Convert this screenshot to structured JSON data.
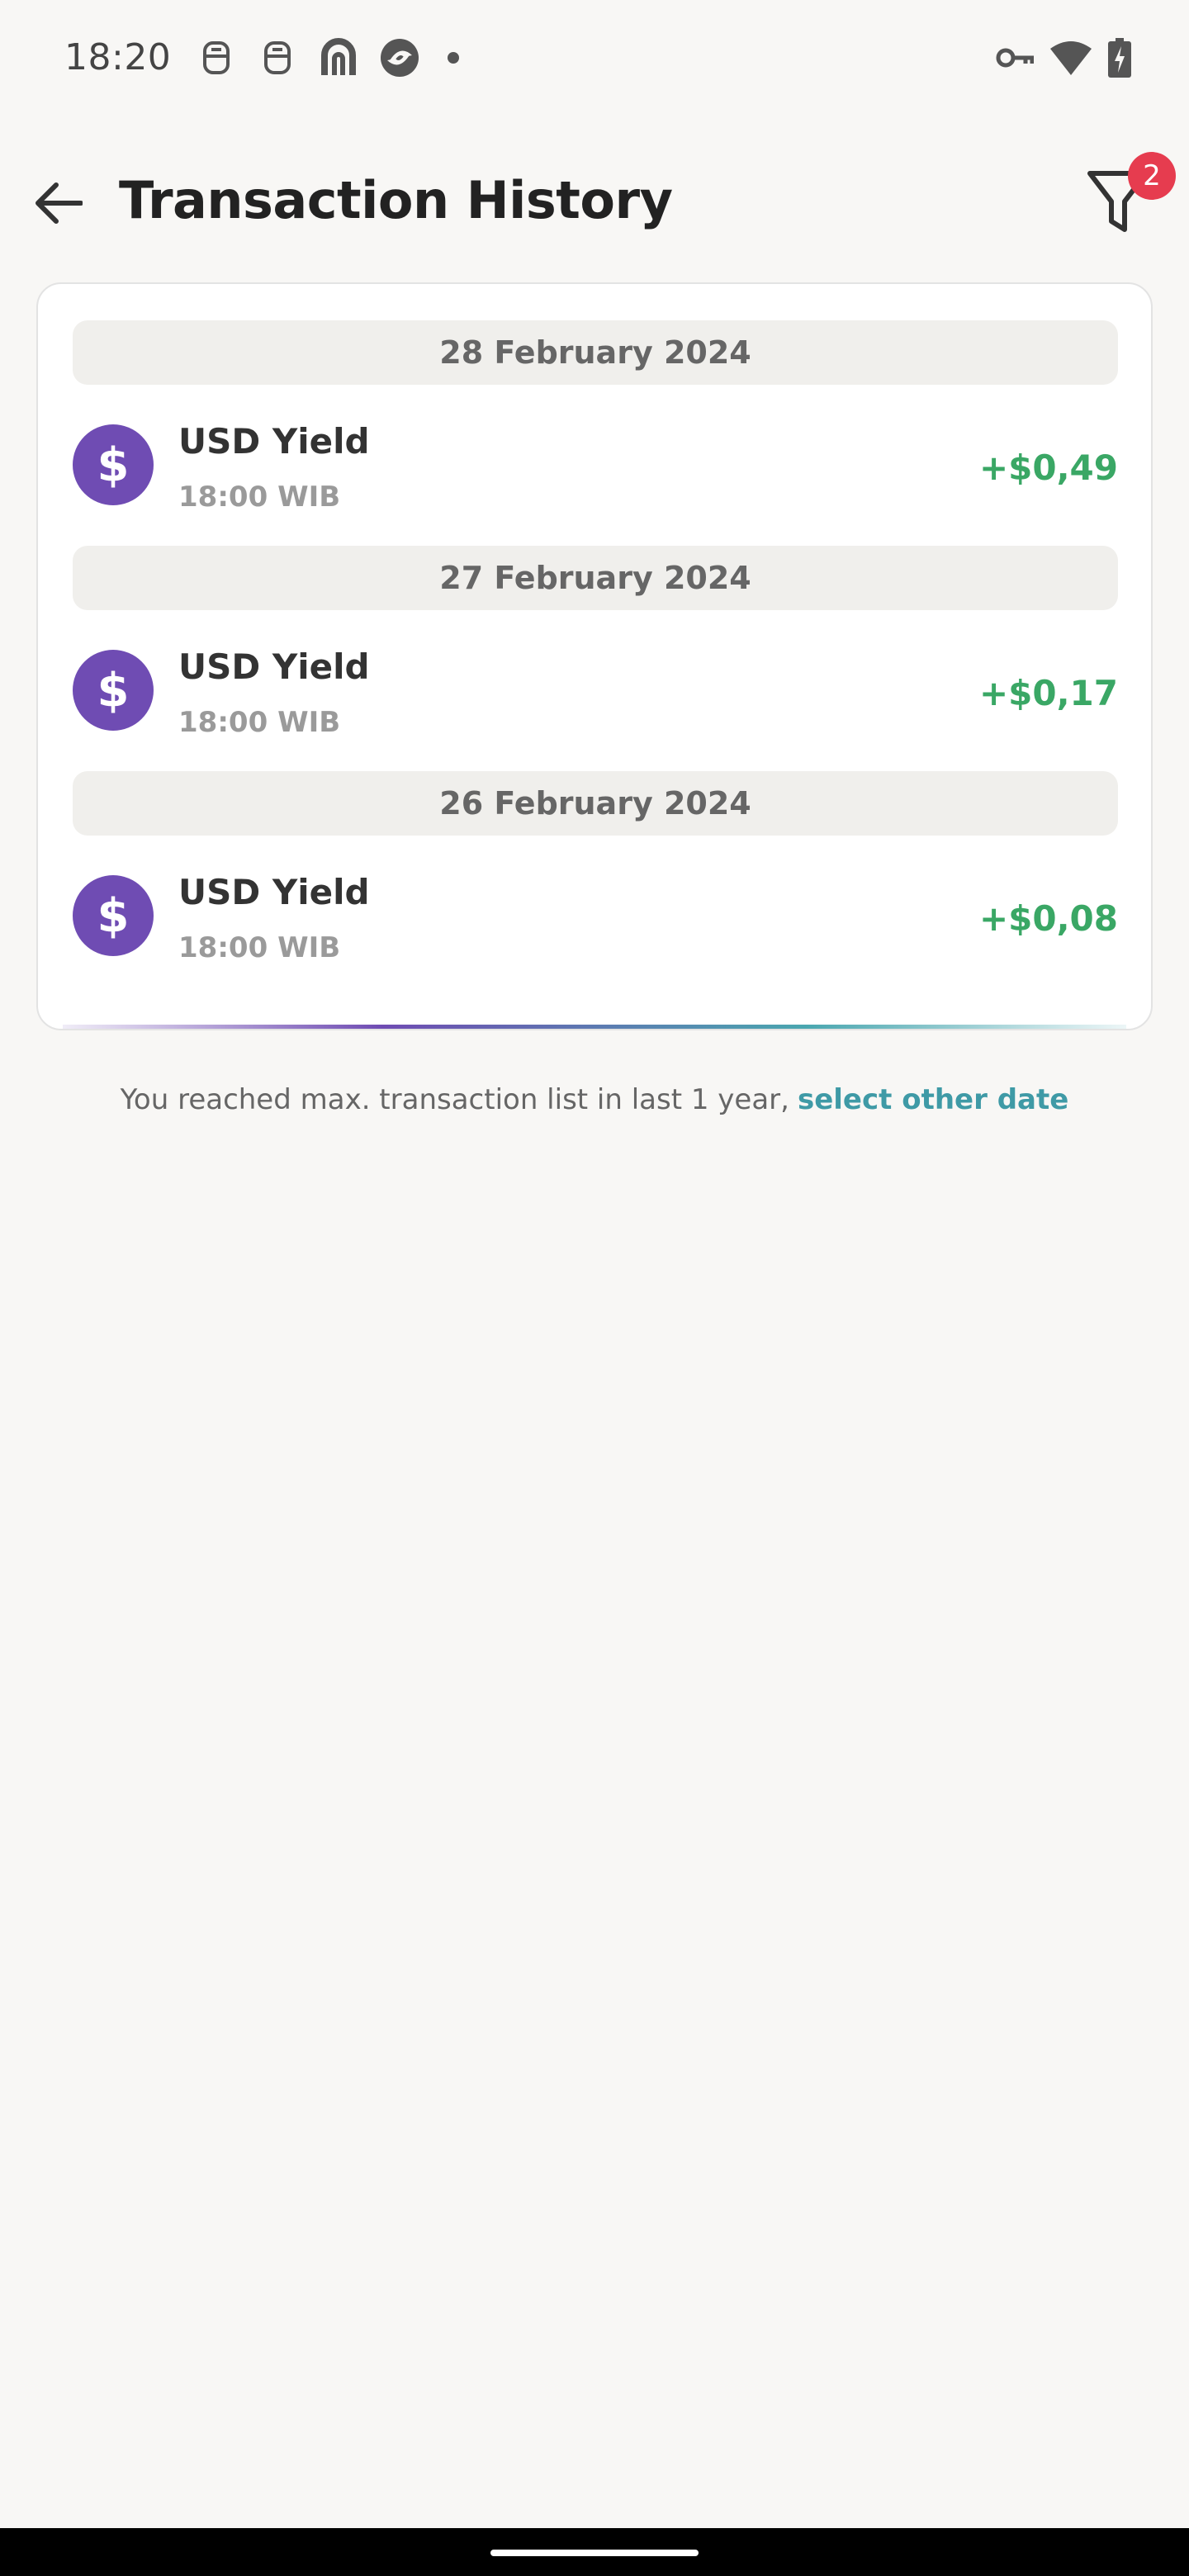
{
  "status_bar": {
    "time": "18:20",
    "left_icons": [
      "notification-app-icon",
      "notification-app-icon",
      "app-logo-icon",
      "app-logo-icon"
    ],
    "right_icons": [
      "vpn-key-icon",
      "wifi-icon",
      "battery-charging-icon"
    ]
  },
  "header": {
    "title": "Transaction History",
    "filter_badge": "2"
  },
  "transactions": [
    {
      "date": "28 February 2024",
      "title": "USD Yield",
      "time": "18:00 WIB",
      "amount": "+$0,49",
      "icon_symbol": "$"
    },
    {
      "date": "27 February 2024",
      "title": "USD Yield",
      "time": "18:00 WIB",
      "amount": "+$0,17",
      "icon_symbol": "$"
    },
    {
      "date": "26 February 2024",
      "title": "USD Yield",
      "time": "18:00 WIB",
      "amount": "+$0,08",
      "icon_symbol": "$"
    }
  ],
  "footer": {
    "note": "You reached max. transaction list in last 1 year,",
    "link": "select other date"
  },
  "colors": {
    "accent_purple": "#6f4cb3",
    "positive_green": "#3aa765",
    "link_teal": "#3f9aa6",
    "badge_red": "#e63c4f"
  }
}
